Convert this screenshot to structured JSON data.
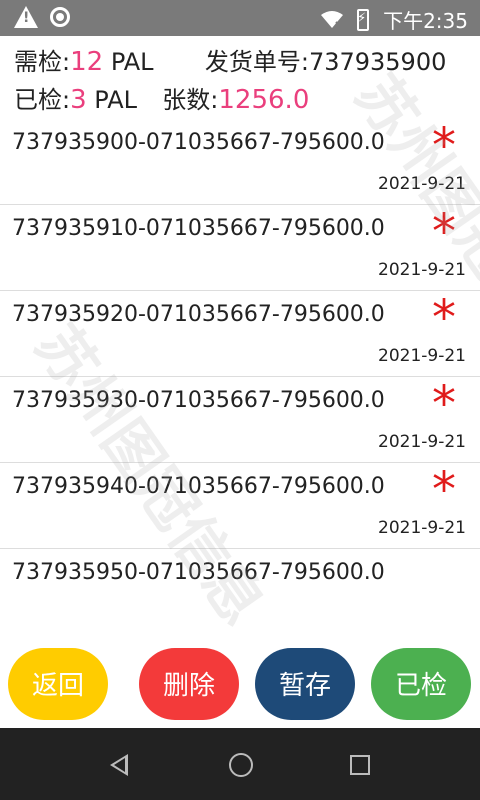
{
  "status_bar": {
    "time": "下午2:35"
  },
  "header": {
    "need_label": "需检:",
    "need_value": "12",
    "need_unit": "PAL",
    "order_label": "发货单号:",
    "order_value": "737935900",
    "done_label": "已检:",
    "done_value": "3",
    "done_unit": "PAL",
    "sheets_label": "张数:",
    "sheets_value": "1256.0"
  },
  "rows": [
    {
      "code": "737935900-071035667-795600.0",
      "star": "*",
      "date": "2021-9-21"
    },
    {
      "code": "737935910-071035667-795600.0",
      "star": "*",
      "date": "2021-9-21"
    },
    {
      "code": "737935920-071035667-795600.0",
      "star": "*",
      "date": "2021-9-21"
    },
    {
      "code": "737935930-071035667-795600.0",
      "star": "*",
      "date": "2021-9-21"
    },
    {
      "code": "737935940-071035667-795600.0",
      "star": "*",
      "date": "2021-9-21"
    },
    {
      "code": "737935950-071035667-795600.0",
      "star": "",
      "date": ""
    }
  ],
  "buttons": {
    "back": "返回",
    "delete": "删除",
    "save": "暂存",
    "checked": "已检"
  },
  "watermark": "苏州图冠信息"
}
